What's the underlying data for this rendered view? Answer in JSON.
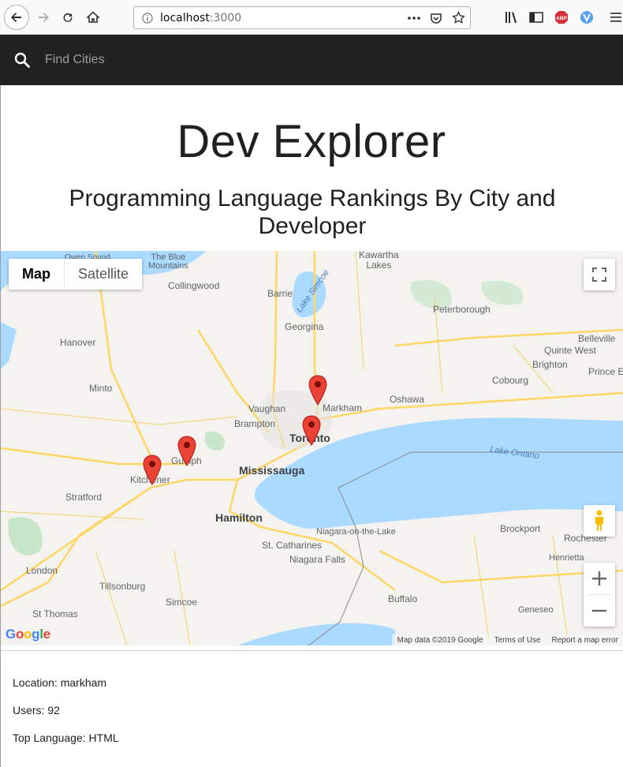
{
  "browser": {
    "url_host": "localhost",
    "url_port": ":3000"
  },
  "header": {
    "search_placeholder": "Find Cities"
  },
  "page": {
    "title": "Dev Explorer",
    "subtitle": "Programming Language Rankings By City and Developer"
  },
  "map": {
    "type_buttons": [
      "Map",
      "Satellite"
    ],
    "markers": [
      "markham",
      "toronto",
      "guelph",
      "kitchener"
    ],
    "labels": {
      "barrie": "Barrie",
      "vaughan": "Vaughan",
      "markham": "Markham",
      "oshawa": "Oshawa",
      "brampton": "Brampton",
      "toronto": "Toronto",
      "mississauga": "Mississauga",
      "guelph": "Guelph",
      "kitchener": "Kitchener",
      "hamilton": "Hamilton",
      "stcatharines": "St. Catharines",
      "niagarafalls": "Niagara Falls",
      "niagaraonlake": "Niagara-on-the-Lake",
      "buffalo": "Buffalo",
      "london": "London",
      "stratford": "Stratford",
      "peterborough": "Peterborough",
      "belleville": "Belleville",
      "cobourg": "Cobourg",
      "brighton": "Brighton",
      "rochester": "Rochester",
      "georgina": "Georgina",
      "collingwood": "Collingwood",
      "hanover": "Hanover",
      "minto": "Minto",
      "simcoe": "Simcoe",
      "tillsonburg": "Tillsonburg",
      "stthomas": "St Thomas",
      "brockport": "Brockport",
      "henrietta": "Henrietta",
      "geneseo": "Geneseo",
      "quintewest": "Quinte West",
      "princee": "Prince E",
      "kawarthalakes": "Kawartha\nLakes",
      "owensound": "Owen Sound",
      "bluemountains": "The Blue\nMountains",
      "lakeontario": "Lake Ontario",
      "lakesimcoe": "Lake Simcoe"
    },
    "attribution": [
      "Map data ©2019 Google",
      "Terms of Use",
      "Report a map error"
    ],
    "logo": "Google"
  },
  "info": {
    "location": "Location: markham",
    "users": "Users: 92",
    "top_language": "Top Language: HTML"
  },
  "colors": {
    "header_bg": "#212121",
    "marker_red": "#ea4335",
    "water": "#aadaff",
    "land": "#f5f3ef"
  }
}
